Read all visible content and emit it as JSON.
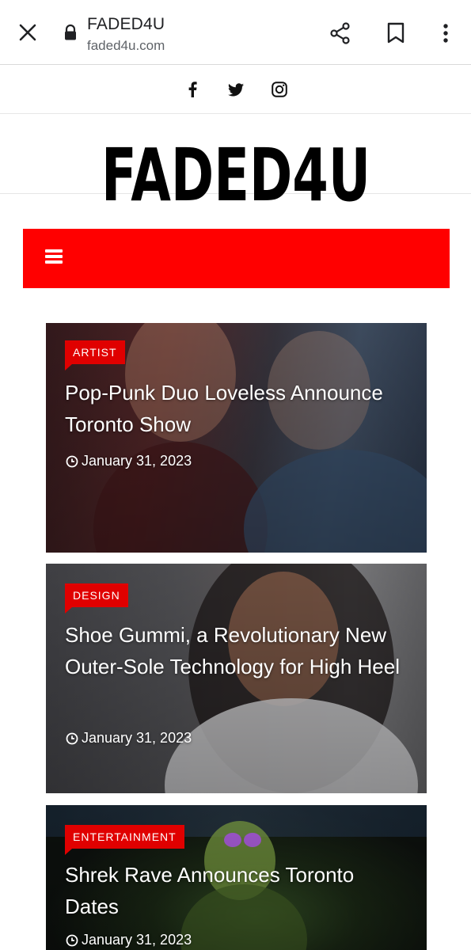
{
  "browser": {
    "title": "FADED4U",
    "url": "faded4u.com"
  },
  "logo_text": "FADED4U",
  "colors": {
    "nav": "#ff0000",
    "badge": "#e00000"
  },
  "articles": [
    {
      "category": "ARTIST",
      "title": "Pop-Punk Duo Loveless Announce Toronto Show",
      "date": "January 31, 2023"
    },
    {
      "category": "DESIGN",
      "title": "Shoe Gummi, a Revolutionary New Outer-Sole Technology for High Heel",
      "date": "January 31, 2023"
    },
    {
      "category": "ENTERTAINMENT",
      "title": "Shrek Rave Announces Toronto Dates",
      "date": "January 31, 2023"
    }
  ]
}
